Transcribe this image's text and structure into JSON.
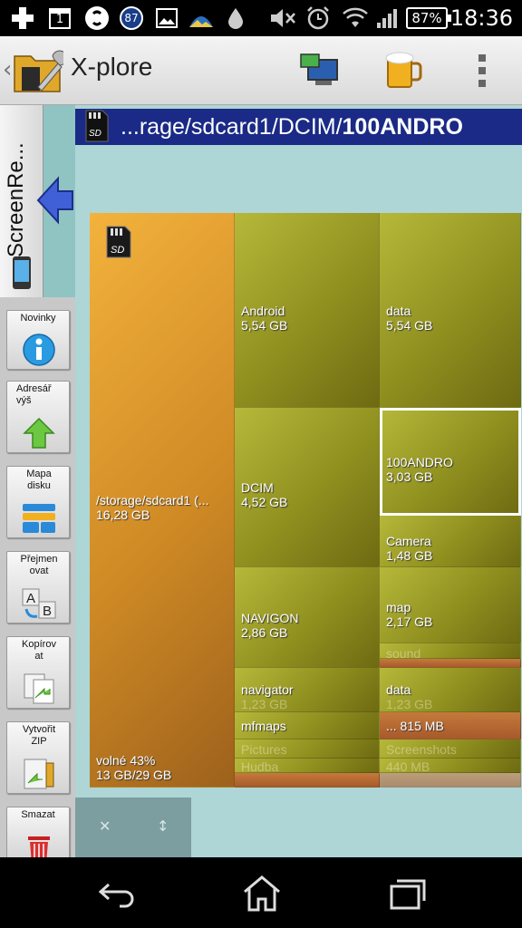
{
  "status_bar": {
    "time": "18:36",
    "battery": "87%",
    "notification_badge": "87",
    "calendar_day": "1"
  },
  "app": {
    "title": "X-plore"
  },
  "left_tab": {
    "label": "ScreenRe..."
  },
  "tools": [
    {
      "label": "Novinky",
      "icon": "info-icon"
    },
    {
      "label": "Adresář výš",
      "icon": "up-arrow-icon"
    },
    {
      "label": "Mapa disku",
      "icon": "disk-map-icon"
    },
    {
      "label": "Přejmen ovat",
      "icon": "rename-icon"
    },
    {
      "label": "Kopírov at",
      "icon": "copy-icon"
    },
    {
      "label": "Vytvořit ZIP",
      "icon": "zip-icon"
    },
    {
      "label": "Smazat",
      "icon": "trash-icon"
    }
  ],
  "path": {
    "prefix": "...rage/sdcard1/DCIM/",
    "current": "100ANDRO"
  },
  "treemap": {
    "root": {
      "name": "/storage/sdcard1 (...",
      "size": "16,28 GB",
      "free_label": "volné 43%",
      "free_size": "13 GB/29 GB"
    },
    "android": {
      "name": "Android",
      "size": "5,54 GB"
    },
    "android_data": {
      "name": "data",
      "size": "5,54 GB"
    },
    "dcim": {
      "name": "DCIM",
      "size": "4,52 GB"
    },
    "androdir": {
      "name": "100ANDRO",
      "size": "3,03 GB"
    },
    "camera": {
      "name": "Camera",
      "size": "1,48 GB"
    },
    "navigon": {
      "name": "NAVIGON",
      "size": "2,86 GB"
    },
    "map": {
      "name": "map",
      "size": "2,17 GB"
    },
    "sound": {
      "name": "sound"
    },
    "navigator": {
      "name": "navigator",
      "size": "1,23 GB"
    },
    "nav_data": {
      "name": "data",
      "size": "1,23 GB"
    },
    "mfmaps": {
      "name": "mfmaps"
    },
    "mfmaps_size": {
      "size": "... 815 MB"
    },
    "pictures": {
      "name": "Pictures"
    },
    "screenshots": {
      "name": "Screenshots"
    },
    "hudba": {
      "name": "Hudba"
    },
    "small_size": {
      "size": "440 MB"
    }
  },
  "colors": {
    "path_bar": "#1a2a86",
    "main_bg": "#aed6d6",
    "olive": "#8f8f1f",
    "orange": "#cf8a25"
  }
}
